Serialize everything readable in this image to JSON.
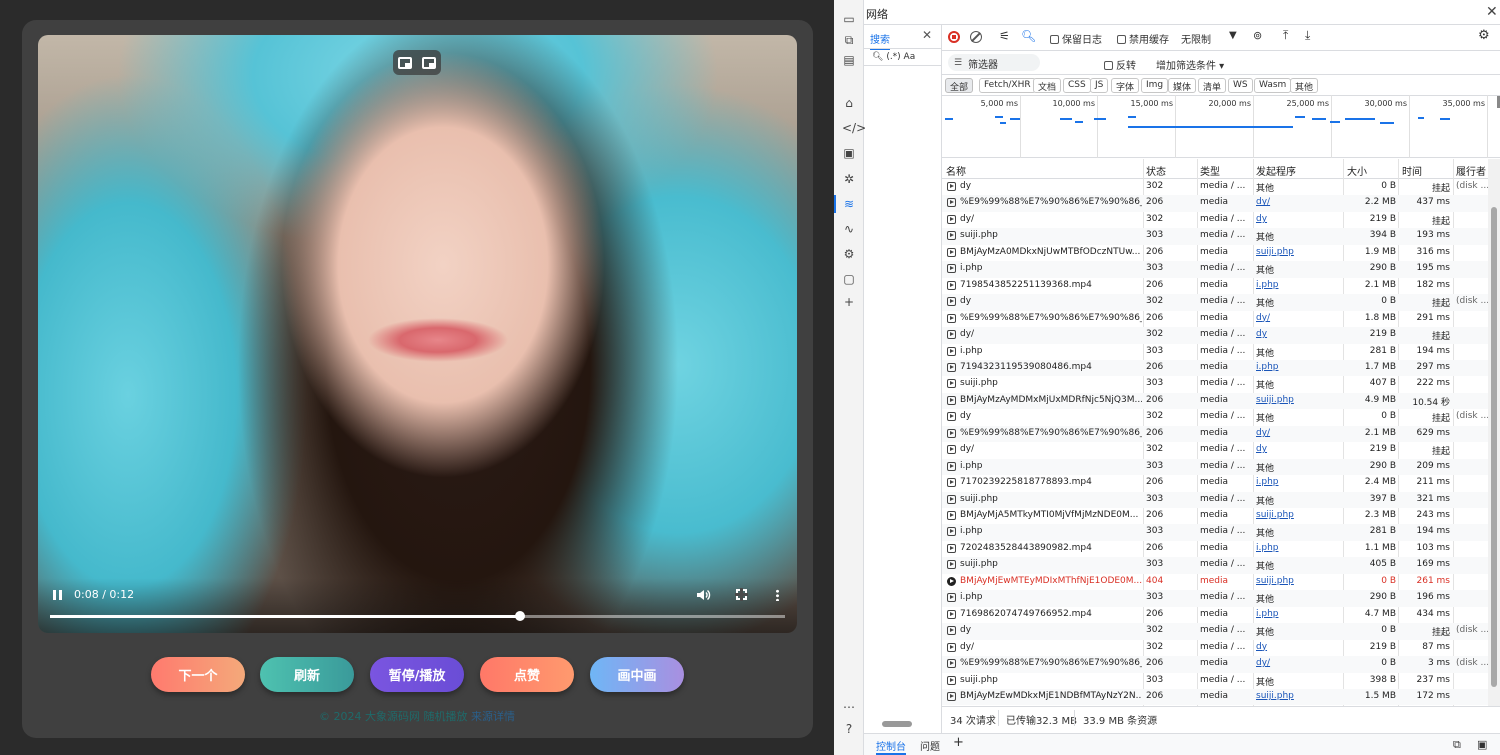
{
  "player": {
    "time": "0:08 / 0:12",
    "progress_fraction": 0.64,
    "buttons": {
      "next": "下一个",
      "refresh": "刷新",
      "pause_play": "暂停/播放",
      "like": "点赞",
      "pip": "画中画"
    },
    "footer_text": "© 2024 大象源码网 随机播放",
    "footer_link": "来源详情"
  },
  "devtools": {
    "title": "网络",
    "search_tab": "搜索",
    "search_options": "(.*) Aa",
    "toolbar": {
      "preserve_log": "保留日志",
      "disable_cache": "禁用缓存",
      "throttle": "无限制"
    },
    "filter_placeholder": "筛选器",
    "invert": "反转",
    "more_filters": "增加筛选条件",
    "type_filters": [
      "全部",
      "Fetch/XHR",
      "文档",
      "CSS",
      "JS",
      "字体",
      "Img",
      "媒体",
      "清单",
      "WS",
      "Wasm",
      "其他"
    ],
    "timeline_ticks": [
      "5,000 ms",
      "10,000 ms",
      "15,000 ms",
      "20,000 ms",
      "25,000 ms",
      "30,000 ms",
      "35,000 ms"
    ],
    "columns": {
      "name": "名称",
      "status": "状态",
      "type": "类型",
      "initiator": "发起程序",
      "size": "大小",
      "time": "时间",
      "fulfilled": "履行者"
    },
    "rows": [
      {
        "name": "dy",
        "status": "302",
        "type": "media / ...",
        "init": "其他",
        "link": false,
        "size": "0 B",
        "time": "挂起",
        "fulfil": "(disk ..."
      },
      {
        "name": "%E9%99%88%E7%90%86%E7%90%86_7...",
        "status": "206",
        "type": "media",
        "init": "dy/",
        "link": true,
        "size": "2.2 MB",
        "time": "437 ms",
        "fulfil": ""
      },
      {
        "name": "dy/",
        "status": "302",
        "type": "media / ...",
        "init": "dy",
        "link": true,
        "size": "219 B",
        "time": "挂起",
        "fulfil": ""
      },
      {
        "name": "suiji.php",
        "status": "303",
        "type": "media / ...",
        "init": "其他",
        "link": false,
        "size": "394 B",
        "time": "193 ms",
        "fulfil": ""
      },
      {
        "name": "BMjAyMzA0MDkxNjUwMTBfODczNTUw...",
        "status": "206",
        "type": "media",
        "init": "suiji.php",
        "link": true,
        "size": "1.9 MB",
        "time": "316 ms",
        "fulfil": ""
      },
      {
        "name": "i.php",
        "status": "303",
        "type": "media / ...",
        "init": "其他",
        "link": false,
        "size": "290 B",
        "time": "195 ms",
        "fulfil": ""
      },
      {
        "name": "7198543852251139368.mp4",
        "status": "206",
        "type": "media",
        "init": "i.php",
        "link": true,
        "size": "2.1 MB",
        "time": "182 ms",
        "fulfil": ""
      },
      {
        "name": "dy",
        "status": "302",
        "type": "media / ...",
        "init": "其他",
        "link": false,
        "size": "0 B",
        "time": "挂起",
        "fulfil": "(disk ..."
      },
      {
        "name": "%E9%99%88%E7%90%86%E7%90%86_7...",
        "status": "206",
        "type": "media",
        "init": "dy/",
        "link": true,
        "size": "1.8 MB",
        "time": "291 ms",
        "fulfil": ""
      },
      {
        "name": "dy/",
        "status": "302",
        "type": "media / ...",
        "init": "dy",
        "link": true,
        "size": "219 B",
        "time": "挂起",
        "fulfil": ""
      },
      {
        "name": "i.php",
        "status": "303",
        "type": "media / ...",
        "init": "其他",
        "link": false,
        "size": "281 B",
        "time": "194 ms",
        "fulfil": ""
      },
      {
        "name": "7194323119539080486.mp4",
        "status": "206",
        "type": "media",
        "init": "i.php",
        "link": true,
        "size": "1.7 MB",
        "time": "297 ms",
        "fulfil": ""
      },
      {
        "name": "suiji.php",
        "status": "303",
        "type": "media / ...",
        "init": "其他",
        "link": false,
        "size": "407 B",
        "time": "222 ms",
        "fulfil": ""
      },
      {
        "name": "BMjAyMzAyMDMxMjUxMDRfNjc5NjQ3M...",
        "status": "206",
        "type": "media",
        "init": "suiji.php",
        "link": true,
        "size": "4.9 MB",
        "time": "10.54 秒",
        "fulfil": ""
      },
      {
        "name": "dy",
        "status": "302",
        "type": "media / ...",
        "init": "其他",
        "link": false,
        "size": "0 B",
        "time": "挂起",
        "fulfil": "(disk ..."
      },
      {
        "name": "%E9%99%88%E7%90%86%E7%90%86_7...",
        "status": "206",
        "type": "media",
        "init": "dy/",
        "link": true,
        "size": "2.1 MB",
        "time": "629 ms",
        "fulfil": ""
      },
      {
        "name": "dy/",
        "status": "302",
        "type": "media / ...",
        "init": "dy",
        "link": true,
        "size": "219 B",
        "time": "挂起",
        "fulfil": ""
      },
      {
        "name": "i.php",
        "status": "303",
        "type": "media / ...",
        "init": "其他",
        "link": false,
        "size": "290 B",
        "time": "209 ms",
        "fulfil": ""
      },
      {
        "name": "7170239225818778893.mp4",
        "status": "206",
        "type": "media",
        "init": "i.php",
        "link": true,
        "size": "2.4 MB",
        "time": "211 ms",
        "fulfil": ""
      },
      {
        "name": "suiji.php",
        "status": "303",
        "type": "media / ...",
        "init": "其他",
        "link": false,
        "size": "397 B",
        "time": "321 ms",
        "fulfil": ""
      },
      {
        "name": "BMjAyMjA5MTkyMTI0MjVfMjMzNDE0M...",
        "status": "206",
        "type": "media",
        "init": "suiji.php",
        "link": true,
        "size": "2.3 MB",
        "time": "243 ms",
        "fulfil": ""
      },
      {
        "name": "i.php",
        "status": "303",
        "type": "media / ...",
        "init": "其他",
        "link": false,
        "size": "281 B",
        "time": "194 ms",
        "fulfil": ""
      },
      {
        "name": "7202483528443890982.mp4",
        "status": "206",
        "type": "media",
        "init": "i.php",
        "link": true,
        "size": "1.1 MB",
        "time": "103 ms",
        "fulfil": ""
      },
      {
        "name": "suiji.php",
        "status": "303",
        "type": "media / ...",
        "init": "其他",
        "link": false,
        "size": "405 B",
        "time": "169 ms",
        "fulfil": ""
      },
      {
        "name": "BMjAyMjEwMTEyMDIxMThfNjE1ODE0M...",
        "status": "404",
        "type": "media",
        "init": "suiji.php",
        "link": true,
        "size": "0 B",
        "time": "261 ms",
        "fulfil": "",
        "error": true
      },
      {
        "name": "i.php",
        "status": "303",
        "type": "media / ...",
        "init": "其他",
        "link": false,
        "size": "290 B",
        "time": "196 ms",
        "fulfil": ""
      },
      {
        "name": "7169862074749766952.mp4",
        "status": "206",
        "type": "media",
        "init": "i.php",
        "link": true,
        "size": "4.7 MB",
        "time": "434 ms",
        "fulfil": ""
      },
      {
        "name": "dy",
        "status": "302",
        "type": "media / ...",
        "init": "其他",
        "link": false,
        "size": "0 B",
        "time": "挂起",
        "fulfil": "(disk ..."
      },
      {
        "name": "dy/",
        "status": "302",
        "type": "media / ...",
        "init": "dy",
        "link": true,
        "size": "219 B",
        "time": "87 ms",
        "fulfil": ""
      },
      {
        "name": "%E9%99%88%E7%90%86%E7%90%86_7...",
        "status": "206",
        "type": "media",
        "init": "dy/",
        "link": true,
        "size": "0 B",
        "time": "3 ms",
        "fulfil": "(disk ..."
      },
      {
        "name": "suiji.php",
        "status": "303",
        "type": "media / ...",
        "init": "其他",
        "link": false,
        "size": "398 B",
        "time": "237 ms",
        "fulfil": ""
      },
      {
        "name": "BMjAyMzEwMDkxMjE1NDBfMTAyNzY2N...",
        "status": "206",
        "type": "media",
        "init": "suiji.php",
        "link": true,
        "size": "1.5 MB",
        "time": "172 ms",
        "fulfil": ""
      }
    ],
    "status_bar": {
      "requests": "34 次请求",
      "transferred": "已传输32.3 MB",
      "resources": "33.9 MB 条资源"
    },
    "drawer_tabs": {
      "console": "控制台",
      "issues": "问题"
    }
  }
}
